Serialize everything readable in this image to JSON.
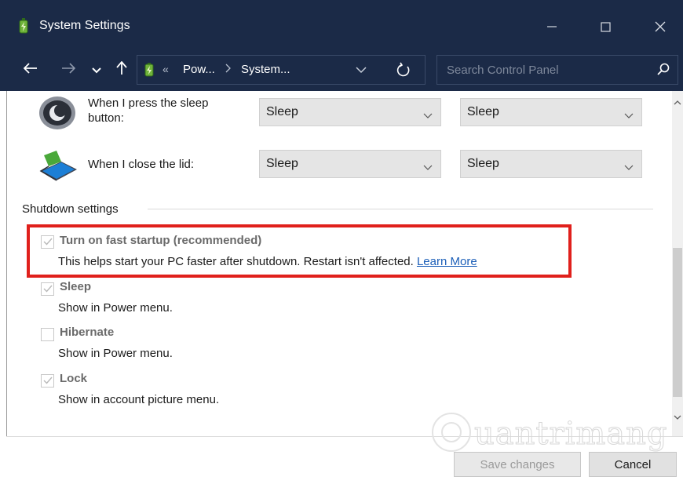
{
  "window": {
    "title": "System Settings",
    "icon": "battery-power-icon"
  },
  "address_bar": {
    "overflow_marker": "«",
    "breadcrumbs": [
      "Pow...",
      "System..."
    ],
    "search_placeholder": "Search Control Panel"
  },
  "power_rows": [
    {
      "label": "When I press the sleep button:",
      "label_line1": "When I press the sleep",
      "label_line2": "button:",
      "icon": "sleep-button-icon",
      "on_battery": "Sleep",
      "plugged_in": "Sleep"
    },
    {
      "label": "When I close the lid:",
      "icon": "laptop-lid-icon",
      "on_battery": "Sleep",
      "plugged_in": "Sleep"
    }
  ],
  "shutdown_settings": {
    "title": "Shutdown settings",
    "options": [
      {
        "title": "Turn on fast startup (recommended)",
        "description": "This helps start your PC faster after shutdown. Restart isn't affected.",
        "link": "Learn More",
        "checked": true,
        "highlighted": true
      },
      {
        "title": "Sleep",
        "description": "Show in Power menu.",
        "checked": true
      },
      {
        "title": "Hibernate",
        "description": "Show in Power menu.",
        "checked": false
      },
      {
        "title": "Lock",
        "description": "Show in account picture menu.",
        "checked": true
      }
    ]
  },
  "footer": {
    "save_label": "Save changes",
    "cancel_label": "Cancel"
  },
  "watermark": "uantrimang",
  "colors": {
    "titlebar": "#1b2a47",
    "highlight_border": "#e0201c",
    "link": "#1c5fb8"
  }
}
